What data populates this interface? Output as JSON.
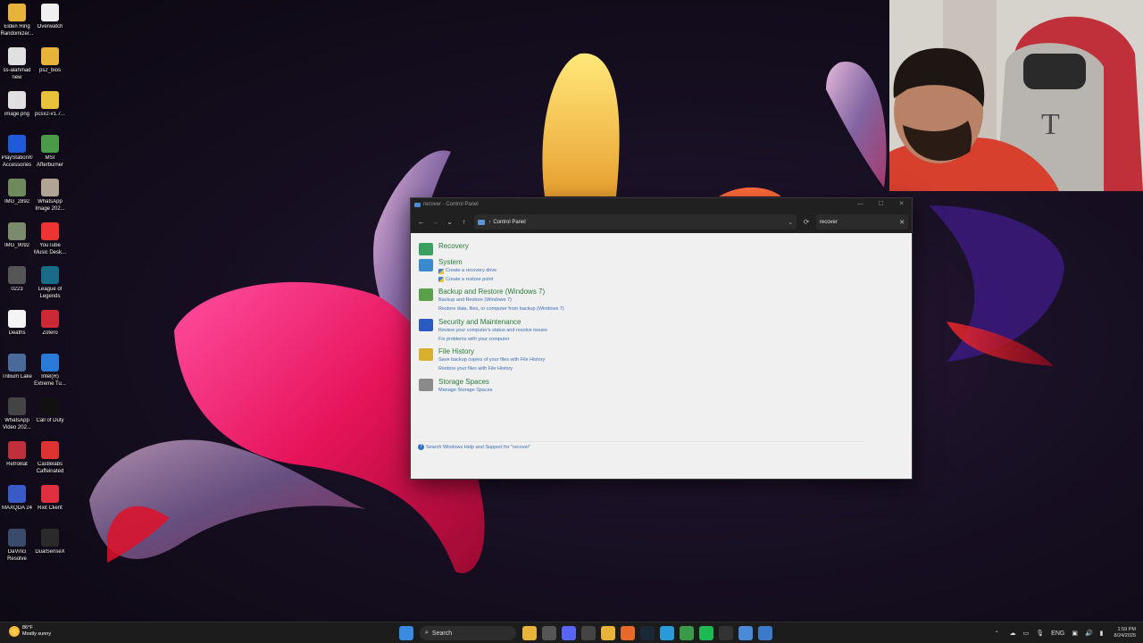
{
  "desktop": {
    "icons": [
      {
        "label": "Elden Ring\nRandomizer...",
        "icon": "folder-icon",
        "color": "#e8b33a"
      },
      {
        "label": "Overwatch",
        "icon": "overwatch-icon",
        "color": "#f0f0f0"
      },
      {
        "label": "ss-alahmad\nnew",
        "icon": "chrome-icon",
        "color": "#e0e0e0"
      },
      {
        "label": "ps2_bios",
        "icon": "folder-icon",
        "color": "#e8b33a"
      },
      {
        "label": "image.png",
        "icon": "chrome-icon",
        "color": "#e0e0e0"
      },
      {
        "label": "pcsx2-v1.7...",
        "icon": "zip-folder-icon",
        "color": "#e8c23a"
      },
      {
        "label": "PlayStation®\nAccessories",
        "icon": "playstation-icon",
        "color": "#1f5bd8"
      },
      {
        "label": "MSI\nAfterburner",
        "icon": "msi-afterburner-icon",
        "color": "#4a9a4a"
      },
      {
        "label": "IMG_2892",
        "icon": "image-file-icon",
        "color": "#6f8a5a"
      },
      {
        "label": "WhatsApp\nImage 202...",
        "icon": "image-file-icon",
        "color": "#b0a595"
      },
      {
        "label": "IMG_9092",
        "icon": "image-file-icon",
        "color": "#7a8a6a"
      },
      {
        "label": "YouTube\nMusic Desk...",
        "icon": "youtube-music-icon",
        "color": "#e33"
      },
      {
        "label": "0223",
        "icon": "video-file-icon",
        "color": "#555"
      },
      {
        "label": "League of\nLegends",
        "icon": "league-of-legends-icon",
        "color": "#1a6a8a"
      },
      {
        "label": "Deaths",
        "icon": "text-file-icon",
        "color": "#f4f4f4"
      },
      {
        "label": "Zotero",
        "icon": "zotero-icon",
        "color": "#cc2936"
      },
      {
        "label": "Trillium Lake",
        "icon": "image-file-icon",
        "color": "#4a6a9a"
      },
      {
        "label": "Intel(R)\nExtreme Tu...",
        "icon": "intel-xtu-icon",
        "color": "#2a7ad8"
      },
      {
        "label": "WhatsApp\nVideo 202...",
        "icon": "video-file-icon",
        "color": "#444"
      },
      {
        "label": "Call of Duty",
        "icon": "call-of-duty-icon",
        "color": "#111"
      },
      {
        "label": "RetroBat",
        "icon": "retrobat-icon",
        "color": "#c0303a"
      },
      {
        "label": "Castlelabs\nCaffeinated",
        "icon": "caffeinated-icon",
        "color": "#d33"
      },
      {
        "label": "MAXQDA 24",
        "icon": "maxqda-icon",
        "color": "#3a5ac8"
      },
      {
        "label": "Riot Client",
        "icon": "riot-client-icon",
        "color": "#e03040"
      },
      {
        "label": "DaVinci\nResolve",
        "icon": "davinci-resolve-icon",
        "color": "#3a4a6a"
      },
      {
        "label": "DualSenseX",
        "icon": "dualsensex-icon",
        "color": "#2a2a2a"
      }
    ]
  },
  "window": {
    "title": "recover - Control Panel",
    "breadcrumb": "Control Panel",
    "search_value": "recover",
    "help_link": "Search Windows Help and Support for \"recover\"",
    "results": [
      {
        "title": "Recovery",
        "icon": "recovery-icon",
        "color": "#3aa060",
        "links": []
      },
      {
        "title": "System",
        "icon": "system-icon",
        "color": "#3a8ad0",
        "links": [
          "Create a recovery drive",
          "Create a restore point"
        ]
      },
      {
        "title": "Backup and Restore (Windows 7)",
        "icon": "backup-restore-icon",
        "color": "#5aa04a",
        "links": [
          "Backup and Restore (Windows 7)",
          "Restore data, files, or computer from backup (Windows 7)"
        ]
      },
      {
        "title": "Security and Maintenance",
        "icon": "flag-icon",
        "color": "#2a5ac0",
        "links": [
          "Review your computer's status and resolve issues",
          "Fix problems with your computer"
        ]
      },
      {
        "title": "File History",
        "icon": "file-history-icon",
        "color": "#d8b030",
        "links": [
          "Save backup copies of your files with File History",
          "Restore your files with File History"
        ]
      },
      {
        "title": "Storage Spaces",
        "icon": "storage-spaces-icon",
        "color": "#8a8a8a",
        "links": [
          "Manage Storage Spaces"
        ]
      }
    ]
  },
  "taskbar": {
    "weather_temp": "86°F",
    "weather_desc": "Mostly sunny",
    "search_label": "Search",
    "language": "ENG",
    "time": "1:59 PM",
    "date": "8/24/2025",
    "apps": [
      {
        "icon": "start-icon",
        "color": "#3a8ae0"
      },
      {
        "icon": "file-explorer-icon",
        "color": "#e8b33a"
      },
      {
        "icon": "task-view-icon",
        "color": "#555"
      },
      {
        "icon": "discord-icon",
        "color": "#5865f2"
      },
      {
        "icon": "copilot-icon",
        "color": "#444"
      },
      {
        "icon": "folder-icon",
        "color": "#e8b33a"
      },
      {
        "icon": "firefox-icon",
        "color": "#e86a2a"
      },
      {
        "icon": "steam-icon",
        "color": "#1b2838"
      },
      {
        "icon": "telegram-icon",
        "color": "#2a9ad8"
      },
      {
        "icon": "chrome-icon",
        "color": "#3a9a4a"
      },
      {
        "icon": "spotify-icon",
        "color": "#1db954"
      },
      {
        "icon": "app-icon",
        "color": "#333"
      },
      {
        "icon": "notepad-icon",
        "color": "#4a8ad8"
      },
      {
        "icon": "control-panel-icon",
        "color": "#3a7ac8"
      }
    ]
  }
}
